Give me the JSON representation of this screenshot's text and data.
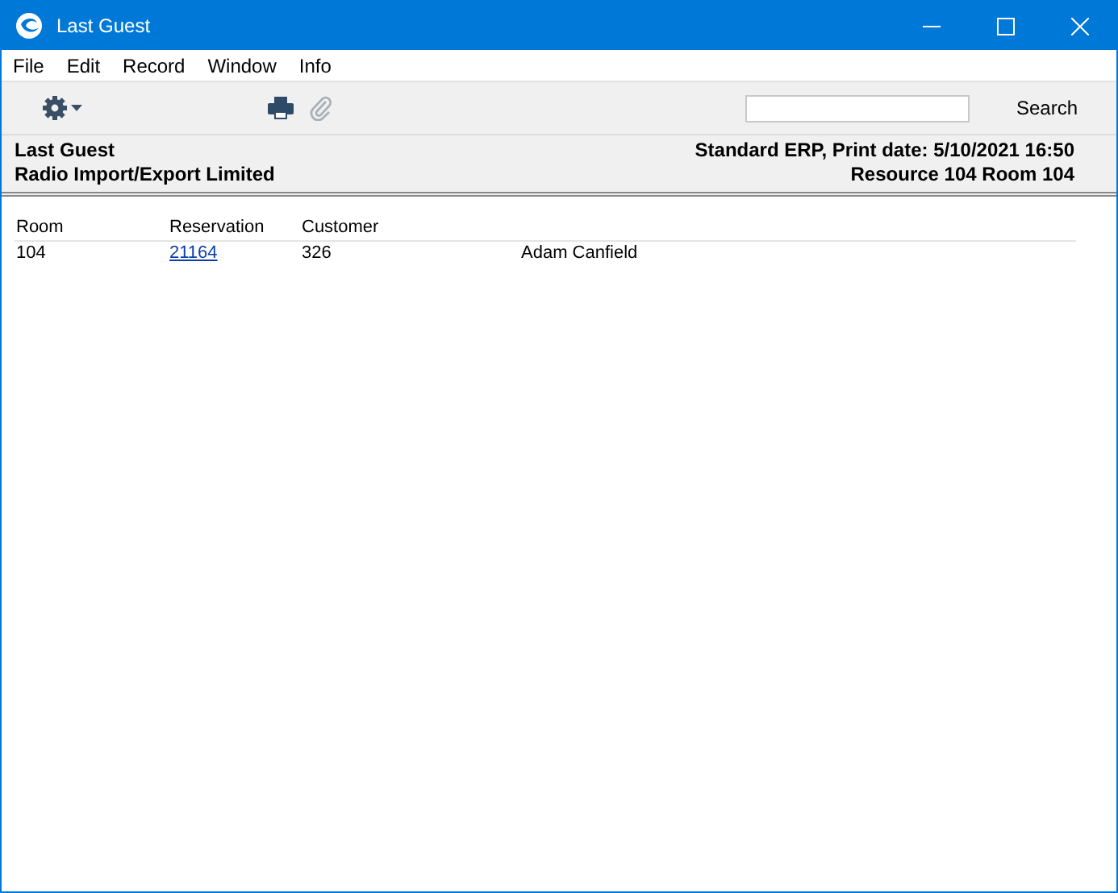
{
  "window": {
    "title": "Last Guest"
  },
  "menu": [
    "File",
    "Edit",
    "Record",
    "Window",
    "Info"
  ],
  "toolbar": {
    "search": {
      "button": "Search"
    }
  },
  "report_header": {
    "title": "Last Guest",
    "company": "Radio Import/Export Limited",
    "print_info": "Standard ERP, Print date: 5/10/2021 16:50",
    "selection": "Resource 104 Room 104"
  },
  "table": {
    "columns": [
      "Room",
      "Reservation",
      "Customer"
    ],
    "rows": [
      {
        "room": "104",
        "reservation": "21164",
        "customer": "326",
        "column_4": "Adam Canfield"
      }
    ]
  }
}
